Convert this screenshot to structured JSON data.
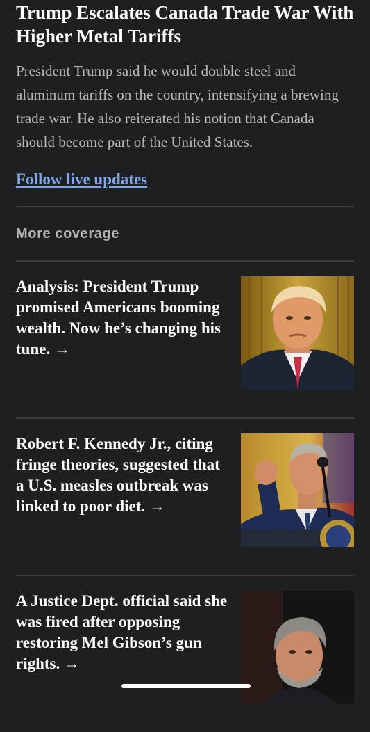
{
  "article": {
    "headline": "Trump Escalates Canada Trade War With Higher Metal Tariffs",
    "summary": "President Trump said he would double steel and aluminum tariffs on the country, intensifying a brewing trade war. He also reiterated his notion that Canada should become part of the United States.",
    "live_link": "Follow live updates"
  },
  "more_coverage": {
    "label": "More coverage",
    "stories": [
      {
        "title": "Analysis: President Trump promised Americans booming wealth. Now he’s changing his tune. →",
        "image": "trump-portrait-photo"
      },
      {
        "title": "Robert F. Kennedy Jr., citing fringe theories, suggested that a U.S. measles outbreak was linked to poor diet. →",
        "image": "rfk-jr-podium-photo"
      },
      {
        "title": "A Justice Dept. official said she was fired after opposing restoring Mel Gibson’s gun rights. →",
        "image": "mel-gibson-photo"
      }
    ]
  },
  "colors": {
    "background": "#1e1f21",
    "headline": "#ffffff",
    "summary": "#b8b8ba",
    "link": "#7fa6e8",
    "divider": "#3d3e41"
  }
}
